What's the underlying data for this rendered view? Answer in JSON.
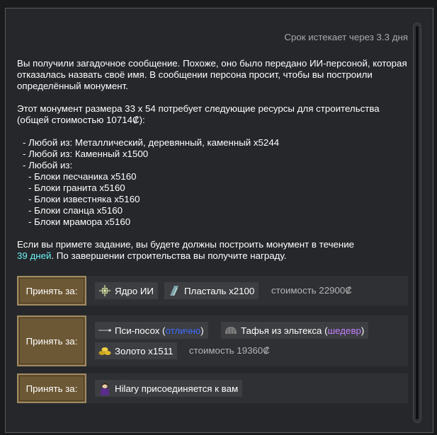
{
  "expiry": "Срок истекает через 3.3 дня",
  "message": {
    "para1": "Вы получили загадочное сообщение. Похоже, оно было передано ИИ-персоной, которая отказалась назвать своё имя. В сообщении персона просит, чтобы вы построили определённый монумент.",
    "para2": "Этот монумент размера 33 x 54 потребует следующие ресурсы для строительства (общей стоимостью 10714₡):",
    "resources": [
      "- Любой из: Металлический, деревянный, каменный x5244",
      "- Любой из: Каменный x1500",
      "- Любой из:"
    ],
    "subresources": [
      "- Блоки песчаника x5160",
      "- Блоки гранита x5160",
      "- Блоки известняка x5160",
      "- Блоки сланца x5160",
      "- Блоки мрамора x5160"
    ],
    "para3_before": "Если вы примете задание, вы будете должны построить монумент в течение",
    "para3_days": "39 дней",
    "para3_after": ". По завершении строительства вы получите награду."
  },
  "offers": [
    {
      "button": "Принять за:",
      "items": [
        {
          "label": "Ядро ИИ",
          "icon": "ai-core-icon"
        },
        {
          "label": "Пласталь x2100",
          "icon": "plasteel-icon"
        }
      ],
      "cost": "стоимость 22900₡"
    },
    {
      "button": "Принять за:",
      "items": [
        {
          "label_before": "Пси-посох (",
          "quality": "отлично",
          "label_after": ")",
          "icon": "psychic-staff-icon"
        },
        {
          "label_before": "Тафья из эльтекса (",
          "quality": "шедевр",
          "label_after": ")",
          "icon": "tuque-icon"
        },
        {
          "label": "Золото x1511",
          "icon": "gold-icon"
        }
      ],
      "cost": "стоимость 19360₡"
    },
    {
      "button": "Принять за:",
      "items": [
        {
          "label": "Hilary присоединяется к вам",
          "icon": "pawn-portrait-icon"
        }
      ]
    }
  ],
  "colors": {
    "background": "#25272a",
    "button": "#6d5835",
    "highlight_days": "#6cf0f5",
    "quality_good": "#3f6dff",
    "quality_masterwork": "#c47fff"
  }
}
